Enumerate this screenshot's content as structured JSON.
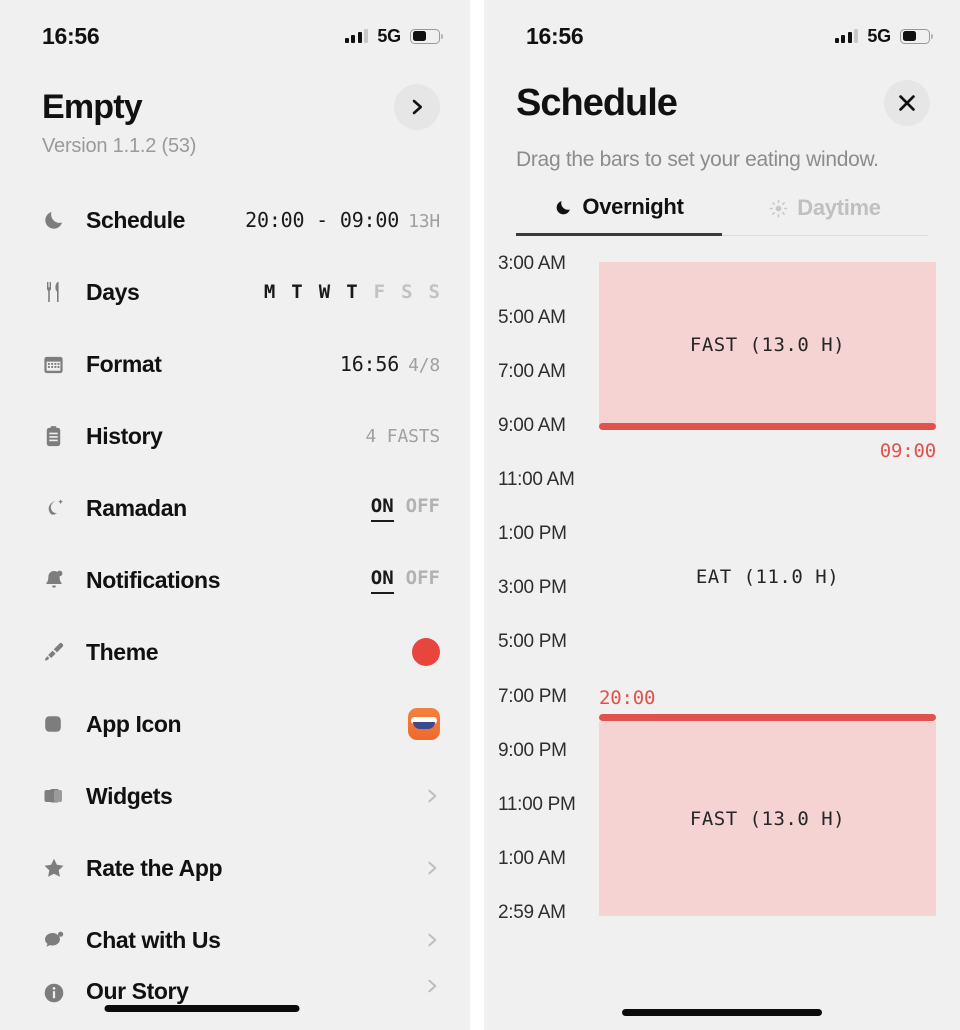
{
  "status_bar": {
    "time": "16:56",
    "network": "5G",
    "signal_icon": "cellular-bars-icon",
    "battery_icon": "battery-icon"
  },
  "left_panel": {
    "title": "Empty",
    "version": "Version 1.1.2 (53)",
    "forward_button_icon": "chevron-right-icon",
    "items": [
      {
        "icon": "moon-icon",
        "label": "Schedule",
        "value_primary": "20:00 - 09:00",
        "value_secondary": "13H",
        "type": "value"
      },
      {
        "icon": "cutlery-icon",
        "label": "Days",
        "type": "days",
        "days": [
          {
            "letter": "M",
            "active": true
          },
          {
            "letter": "T",
            "active": true
          },
          {
            "letter": "W",
            "active": true
          },
          {
            "letter": "T",
            "active": true
          },
          {
            "letter": "F",
            "active": false
          },
          {
            "letter": "S",
            "active": false
          },
          {
            "letter": "S",
            "active": false
          }
        ]
      },
      {
        "icon": "calendar-icon",
        "label": "Format",
        "value_primary": "16:56",
        "value_secondary": "4/8",
        "type": "value"
      },
      {
        "icon": "clipboard-icon",
        "label": "History",
        "value_primary": "",
        "value_secondary": "4 FASTS",
        "type": "value"
      },
      {
        "icon": "crescent-star-icon",
        "label": "Ramadan",
        "type": "toggle",
        "on_label": "ON",
        "off_label": "OFF",
        "state": "ON"
      },
      {
        "icon": "bell-icon",
        "label": "Notifications",
        "type": "toggle",
        "on_label": "ON",
        "off_label": "OFF",
        "state": "ON"
      },
      {
        "icon": "paintbrush-icon",
        "label": "Theme",
        "type": "swatch",
        "color": "#e8453c"
      },
      {
        "icon": "square-icon",
        "label": "App Icon",
        "type": "appicon"
      },
      {
        "icon": "widgets-icon",
        "label": "Widgets",
        "type": "chevron"
      },
      {
        "icon": "star-icon",
        "label": "Rate the App",
        "type": "chevron"
      },
      {
        "icon": "chat-bubble-icon",
        "label": "Chat with Us",
        "type": "chevron"
      },
      {
        "icon": "info-icon",
        "label": "Our Story",
        "type": "chevron"
      }
    ]
  },
  "right_panel": {
    "title": "Schedule",
    "close_button_icon": "close-icon",
    "subtitle": "Drag the bars to set your eating window.",
    "tabs": [
      {
        "label": "Overnight",
        "icon": "moon-icon",
        "active": true
      },
      {
        "label": "Daytime",
        "icon": "sun-icon",
        "active": false
      }
    ],
    "chart_data": {
      "type": "bar",
      "title": "Schedule",
      "orientation": "vertical-time-axis",
      "axis_start": "3:00 AM",
      "axis_end": "2:59 AM",
      "tick_labels": [
        "3:00 AM",
        "5:00 AM",
        "7:00 AM",
        "9:00 AM",
        "11:00 AM",
        "1:00 PM",
        "3:00 PM",
        "5:00 PM",
        "7:00 PM",
        "9:00 PM",
        "11:00 PM",
        "1:00 AM",
        "2:59 AM"
      ],
      "segments": [
        {
          "name": "FAST",
          "label": "FAST (13.0 H)",
          "start": "3:00 AM",
          "end": "9:00 AM",
          "hours": 6.0,
          "filled": true
        },
        {
          "name": "EAT",
          "label": "EAT (11.0 H)",
          "start": "9:00 AM",
          "end": "8:00 PM",
          "hours": 11.0,
          "filled": false
        },
        {
          "name": "FAST",
          "label": "FAST (13.0 H)",
          "start": "8:00 PM",
          "end": "2:59 AM",
          "hours": 7.0,
          "filled": true
        }
      ],
      "handles": [
        {
          "name": "fast-end-handle",
          "time_label": "09:00",
          "position": "9:00 AM"
        },
        {
          "name": "fast-start-handle",
          "time_label": "20:00",
          "position": "8:00 PM"
        }
      ],
      "fast_hours": 13.0,
      "eat_hours": 11.0,
      "colors": {
        "block": "#f6d3d3",
        "handle": "#e0534c",
        "handle_text": "#e0534c"
      },
      "grid": false,
      "legend": "none"
    }
  }
}
